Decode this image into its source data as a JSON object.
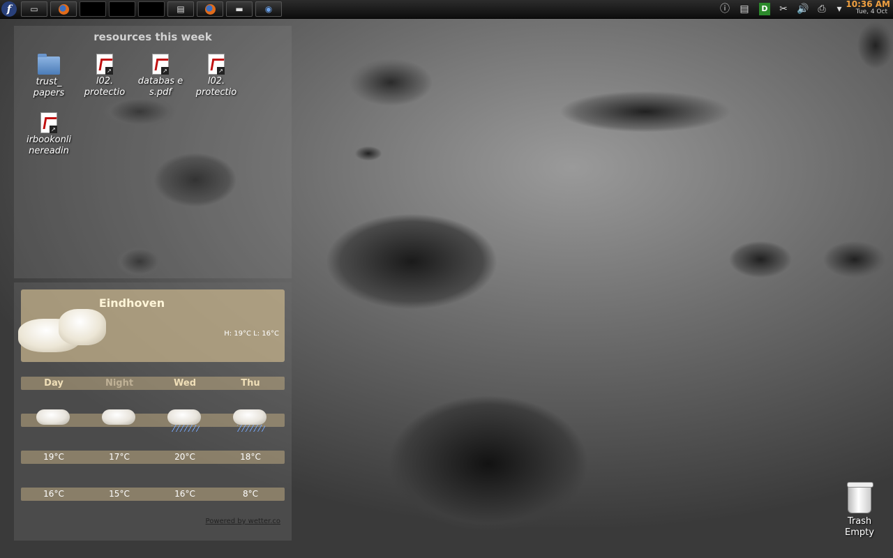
{
  "panel": {
    "launchers": [
      {
        "name": "fedora-menu",
        "icon": "fedora-logo",
        "glyph": "f"
      },
      {
        "name": "show-desktop",
        "icon": "desktop-icon",
        "glyph": "▭"
      },
      {
        "name": "firefox-launcher",
        "icon": "firefox-icon",
        "glyph": ""
      },
      {
        "name": "empty-slot-1",
        "icon": "",
        "glyph": ""
      },
      {
        "name": "empty-slot-2",
        "icon": "",
        "glyph": ""
      },
      {
        "name": "empty-slot-3",
        "icon": "",
        "glyph": ""
      },
      {
        "name": "workspace-switcher",
        "icon": "workspace-icon",
        "glyph": "▤"
      },
      {
        "name": "firefox-launcher-2",
        "icon": "firefox-icon",
        "glyph": ""
      },
      {
        "name": "minimized-window",
        "icon": "window-icon",
        "glyph": "▬"
      },
      {
        "name": "app-launcher",
        "icon": "app-icon",
        "glyph": "◉"
      }
    ],
    "tray": {
      "info_glyph": "ⓘ",
      "clipboard_glyph": "▤",
      "d_glyph": "D",
      "scissors_glyph": "✂",
      "volume_glyph": "🔊",
      "printer_glyph": "⎙",
      "arrow_glyph": "▾"
    },
    "clock": {
      "time": "10:36 AM",
      "date": "Tue, 4 Oct"
    }
  },
  "resources": {
    "title": "resources this week",
    "icons": [
      {
        "label": "trust_\npapers",
        "type": "folder-icon"
      },
      {
        "label": "l02.\nprotectio",
        "type": "pdf-icon"
      },
      {
        "label": "databas e\ns.pdf",
        "type": "pdf-icon"
      },
      {
        "label": "l02.\nprotectio",
        "type": "pdf-icon"
      },
      {
        "label": "irbookonli\nnereadin",
        "type": "pdf-icon"
      }
    ]
  },
  "weather": {
    "city": "Eindhoven",
    "hilo": "H: 19°C L: 16°C",
    "headers": [
      "Day",
      "Night",
      "Wed",
      "Thu"
    ],
    "icons": [
      "cloudy",
      "cloudy",
      "rain",
      "rain"
    ],
    "highs": [
      "19°C",
      "17°C",
      "20°C",
      "18°C"
    ],
    "lows": [
      "16°C",
      "15°C",
      "16°C",
      "8°C"
    ],
    "powered": "Powered by wetter.co"
  },
  "trash": {
    "label": "Trash",
    "status": "Empty"
  }
}
